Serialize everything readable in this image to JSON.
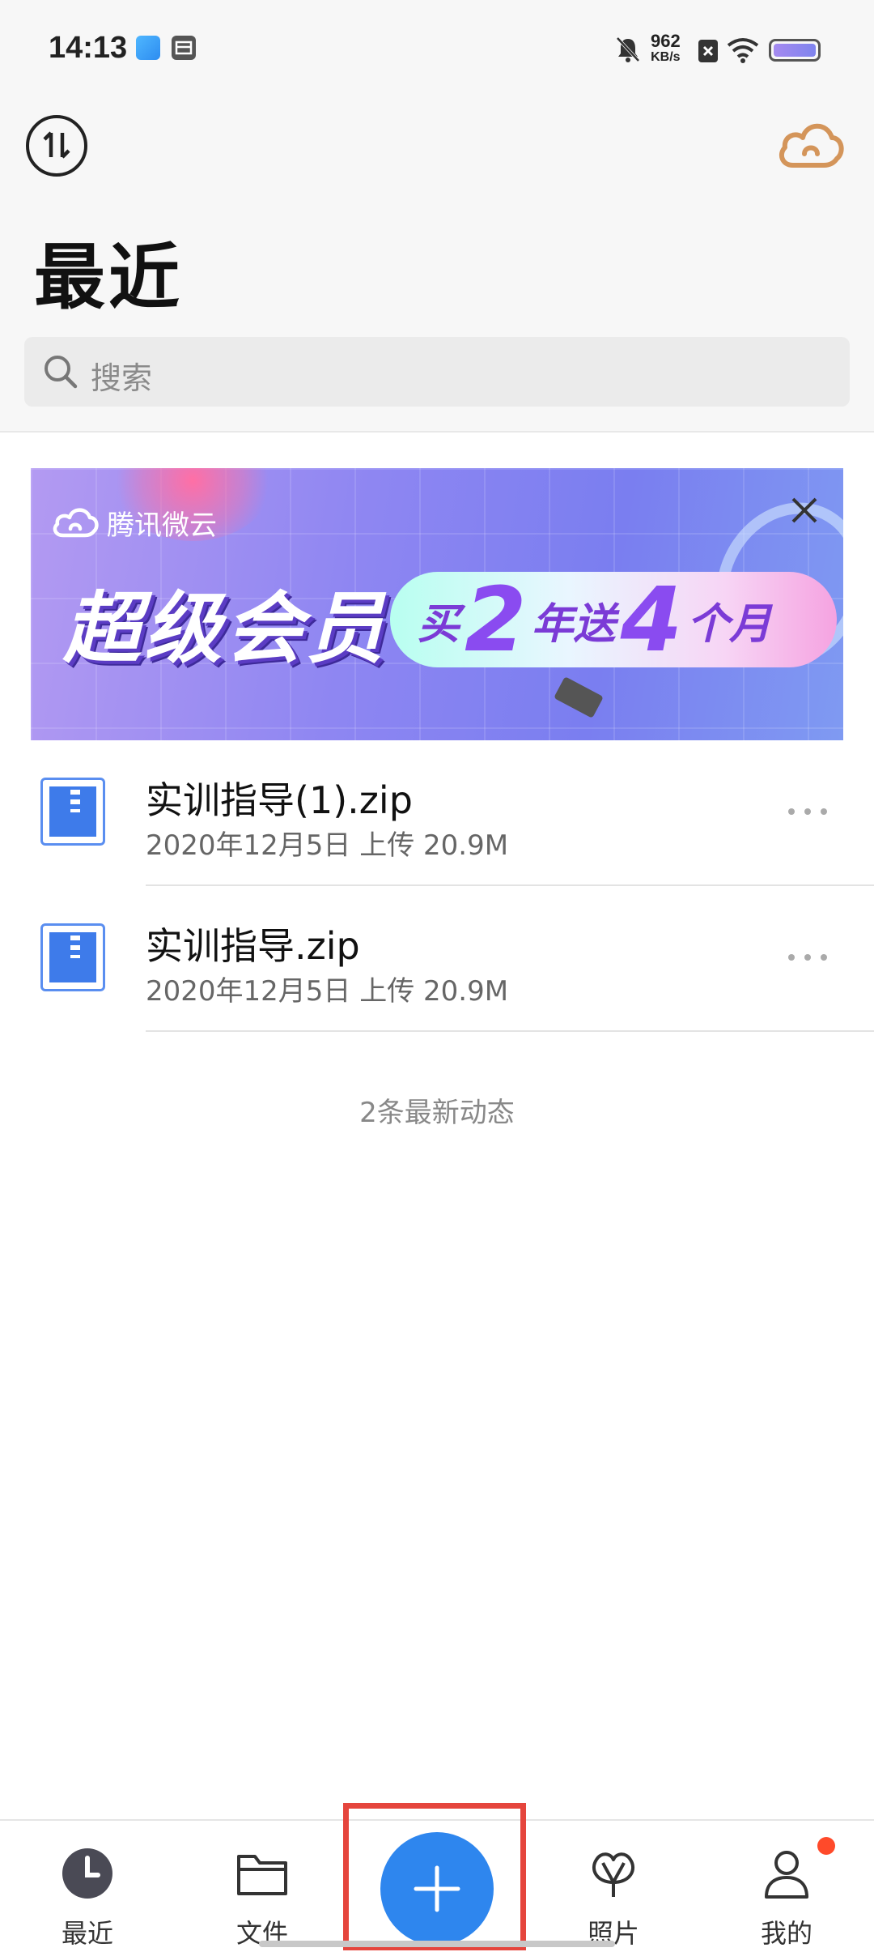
{
  "status_bar": {
    "time": "14:13",
    "net_speed_value": "962",
    "net_speed_unit": "KB/s",
    "icons": [
      "weather-app-icon",
      "inbox-app-icon",
      "mute-icon",
      "sim-x-icon",
      "wifi-icon",
      "battery-icon"
    ]
  },
  "header": {
    "title": "最近",
    "search_placeholder": "搜索",
    "left_icon": "sort-toggle-icon",
    "right_icon": "cloud-icon"
  },
  "banner": {
    "brand": "腾讯微云",
    "headline": "超级会员",
    "pill_text_1": "买",
    "pill_big_1": "2",
    "pill_text_2": "年送",
    "pill_big_2": "4",
    "pill_text_3": "个月"
  },
  "files": [
    {
      "name": "实训指导(1).zip",
      "meta": "2020年12月5日  上传  20.9M"
    },
    {
      "name": "实训指导.zip",
      "meta": "2020年12月5日  上传  20.9M"
    }
  ],
  "activity_count": "2条最新动态",
  "bottom_nav": {
    "items": [
      {
        "label": "最近",
        "icon": "clock-icon"
      },
      {
        "label": "文件",
        "icon": "folder-icon"
      },
      {
        "label": "照片",
        "icon": "photo-balloon-icon"
      },
      {
        "label": "我的",
        "icon": "user-icon"
      }
    ],
    "fab_icon": "plus-icon"
  },
  "colors": {
    "accent": "#2e86ee",
    "highlight_box": "#e5453d",
    "badge": "#ff4a2a",
    "cloud_icon": "#d4955a",
    "file_icon": "#3e7bea"
  }
}
